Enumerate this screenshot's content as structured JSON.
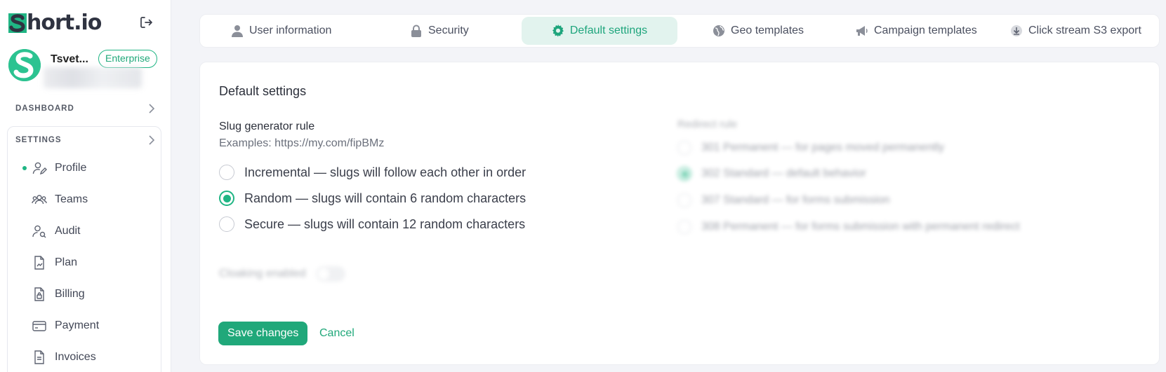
{
  "brand": {
    "logo_text": "hort.io",
    "logo_initial": "S",
    "accent": "#20b584"
  },
  "user": {
    "name": "Tsvet...",
    "plan": "Enterprise"
  },
  "sidebar": {
    "dashboard_label": "DASHBOARD",
    "settings_label": "SETTINGS",
    "items": [
      {
        "label": "Profile",
        "icon": "user-edit-icon",
        "active": true
      },
      {
        "label": "Teams",
        "icon": "team-icon",
        "active": false
      },
      {
        "label": "Audit",
        "icon": "user-search-icon",
        "active": false
      },
      {
        "label": "Plan",
        "icon": "document-chart-icon",
        "active": false
      },
      {
        "label": "Billing",
        "icon": "document-lock-icon",
        "active": false
      },
      {
        "label": "Payment",
        "icon": "credit-card-icon",
        "active": false
      },
      {
        "label": "Invoices",
        "icon": "invoice-icon",
        "active": false
      }
    ]
  },
  "tabs": [
    {
      "label": "User information",
      "icon": "user-icon",
      "active": false
    },
    {
      "label": "Security",
      "icon": "lock-icon",
      "active": false
    },
    {
      "label": "Default settings",
      "icon": "gear-icon",
      "active": true
    },
    {
      "label": "Geo templates",
      "icon": "globe-icon",
      "active": false
    },
    {
      "label": "Campaign templates",
      "icon": "megaphone-icon",
      "active": false
    },
    {
      "label": "Click stream S3 export",
      "icon": "download-icon",
      "active": false
    }
  ],
  "main": {
    "title": "Default settings",
    "slug": {
      "label": "Slug generator rule",
      "hint": "Examples: https://my.com/fipBMz",
      "options": [
        {
          "label": "Incremental — slugs will follow each other in order",
          "checked": false
        },
        {
          "label": "Random — slugs will contain 6 random characters",
          "checked": true
        },
        {
          "label": "Secure — slugs will contain 12 random characters",
          "checked": false
        }
      ]
    },
    "redirect": {
      "label": "Redirect rule",
      "options": [
        {
          "label": "301 Permanent — for pages moved permanently",
          "checked": false
        },
        {
          "label": "302 Standard — default behavior",
          "checked": true
        },
        {
          "label": "307 Standard — for forms submission",
          "checked": false
        },
        {
          "label": "308 Permanent — for forms submission with permanent redirect",
          "checked": false
        }
      ]
    },
    "cloaking_label": "Cloaking enabled",
    "cloaking_enabled": false,
    "save_label": "Save changes",
    "cancel_label": "Cancel"
  }
}
